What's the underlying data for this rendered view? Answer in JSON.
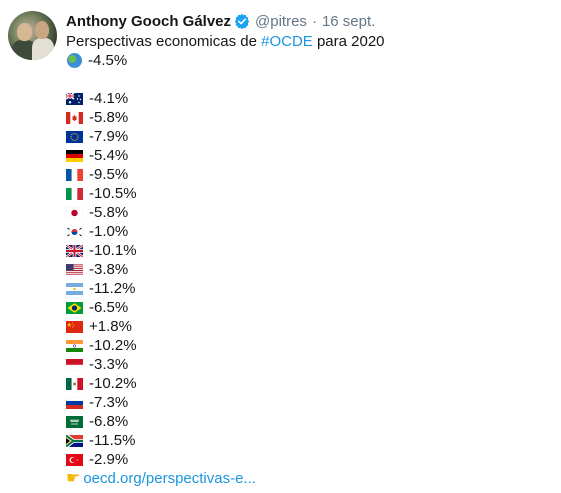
{
  "tweet": {
    "author_name": "Anthony Gooch Gálvez",
    "handle": "@pitres",
    "separator": "·",
    "date": "16 sept.",
    "text_before": "Perspectivas economicas de ",
    "hashtag": "#OCDE",
    "text_after": " para 2020",
    "world": {
      "icon": "globe-icon",
      "value": "-4.5%"
    },
    "countries": [
      {
        "flag": "australia-flag-icon",
        "value": "-4.1%"
      },
      {
        "flag": "canada-flag-icon",
        "value": "-5.8%"
      },
      {
        "flag": "eu-flag-icon",
        "value": "-7.9%"
      },
      {
        "flag": "germany-flag-icon",
        "value": "-5.4%"
      },
      {
        "flag": "france-flag-icon",
        "value": "-9.5%"
      },
      {
        "flag": "italy-flag-icon",
        "value": "-10.5%"
      },
      {
        "flag": "japan-flag-icon",
        "value": "-5.8%"
      },
      {
        "flag": "south-korea-flag-icon",
        "value": "-1.0%"
      },
      {
        "flag": "uk-flag-icon",
        "value": "-10.1%"
      },
      {
        "flag": "usa-flag-icon",
        "value": "-3.8%"
      },
      {
        "flag": "argentina-flag-icon",
        "value": "-11.2%"
      },
      {
        "flag": "brazil-flag-icon",
        "value": "-6.5%"
      },
      {
        "flag": "china-flag-icon",
        "value": "+1.8%"
      },
      {
        "flag": "india-flag-icon",
        "value": "-10.2%"
      },
      {
        "flag": "indonesia-flag-icon",
        "value": "-3.3%"
      },
      {
        "flag": "mexico-flag-icon",
        "value": "-10.2%"
      },
      {
        "flag": "russia-flag-icon",
        "value": "-7.3%"
      },
      {
        "flag": "saudi-arabia-flag-icon",
        "value": "-6.8%"
      },
      {
        "flag": "south-africa-flag-icon",
        "value": "-11.5%"
      },
      {
        "flag": "turkey-flag-icon",
        "value": "-2.9%"
      }
    ],
    "link_icon": "pointing-hand-icon",
    "link_text": "oecd.org/perspectivas-e..."
  },
  "colors": {
    "text": "#14171a",
    "secondary": "#657786",
    "link": "#1b95e0",
    "verified": "#1da1f2"
  }
}
